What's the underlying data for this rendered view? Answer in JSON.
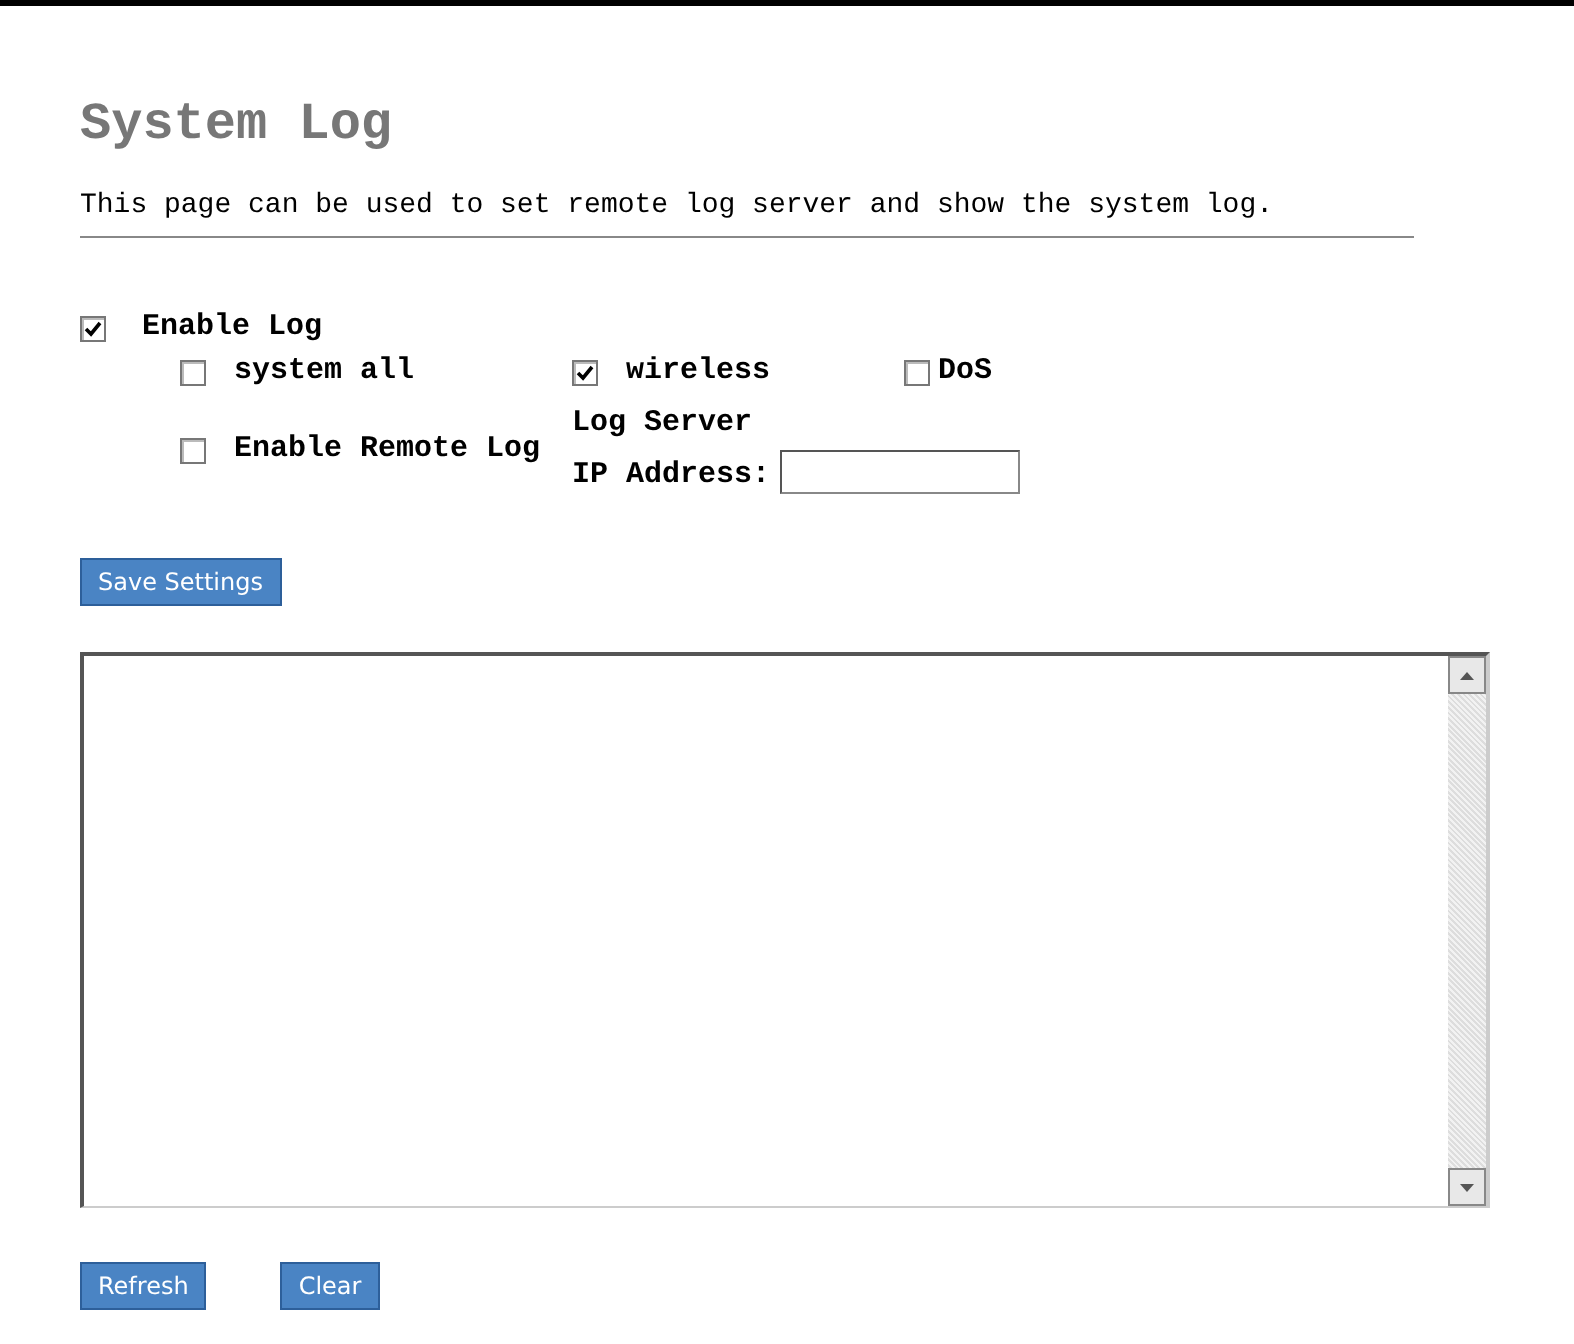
{
  "title": "System Log",
  "description": "This page can be used to set remote log server and show the system log.",
  "enable_log": {
    "label": "Enable Log",
    "checked": true
  },
  "log_types": [
    {
      "label": "system all",
      "checked": false
    },
    {
      "label": "wireless",
      "checked": true
    },
    {
      "label": "DoS",
      "checked": false
    }
  ],
  "remote_log": {
    "label": "Enable Remote Log",
    "checked": false
  },
  "server_ip": {
    "label": "Log Server IP Address:"
  },
  "save_button": "Save Settings",
  "buttons": [
    "Refresh",
    "Clear"
  ]
}
